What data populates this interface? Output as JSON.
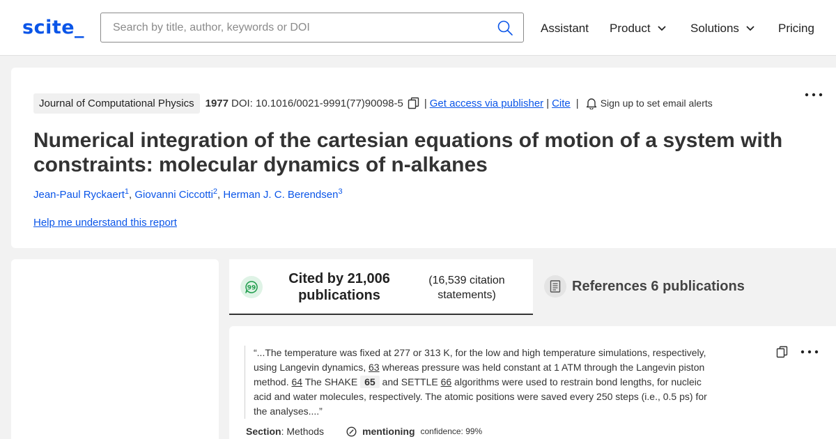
{
  "header": {
    "logo": "scite_",
    "search_placeholder": "Search by title, author, keywords or DOI",
    "nav": {
      "assistant": "Assistant",
      "product": "Product",
      "solutions": "Solutions",
      "pricing": "Pricing"
    },
    "accent_color": "#0a55e8"
  },
  "article": {
    "journal": "Journal of Computational Physics",
    "year": "1977",
    "doi": "DOI: 10.1016/0021-9991(77)90098-5",
    "separator": "|",
    "access_link": "Get access via publisher",
    "cite_link": "Cite",
    "alert_text": "Sign up to set email alerts",
    "title": "Numerical integration of the cartesian equations of motion of a system with constraints: molecular dynamics of n-alkanes",
    "authors": [
      {
        "name": "Jean-Paul Ryckaert",
        "sup": "1"
      },
      {
        "name": "Giovanni Ciccotti",
        "sup": "2"
      },
      {
        "name": "Herman J. C. Berendsen",
        "sup": "3"
      }
    ],
    "comma": ",",
    "help_link": "Help me understand this report"
  },
  "tabs": {
    "cited_by": "Cited by 21,006 publications",
    "citation_statements": "(16,539 citation statements)",
    "references": "References 6 publications"
  },
  "citation": {
    "quote_parts": {
      "p1": "“...The temperature was fixed at 277 or 313 K, for the low and high temperature simulations, respectively, using Langevin dynamics, ",
      "r1": "63",
      "p2": " whereas pressure was held constant at 1 ATM through the Langevin piston method. ",
      "r2": "64",
      "p3": " The SHAKE ",
      "r3": "65",
      "p4": " and SETTLE ",
      "r4": "66",
      "p5": " algorithms were used to restrain bond lengths, for nucleic acid and water molecules, respectively. The atomic positions were saved every 250 steps (i.e., 0.5 ps) for the analyses....”"
    },
    "section_label": "Section",
    "section_value": ": Methods",
    "classification": "mentioning",
    "confidence": "confidence: 99%"
  }
}
